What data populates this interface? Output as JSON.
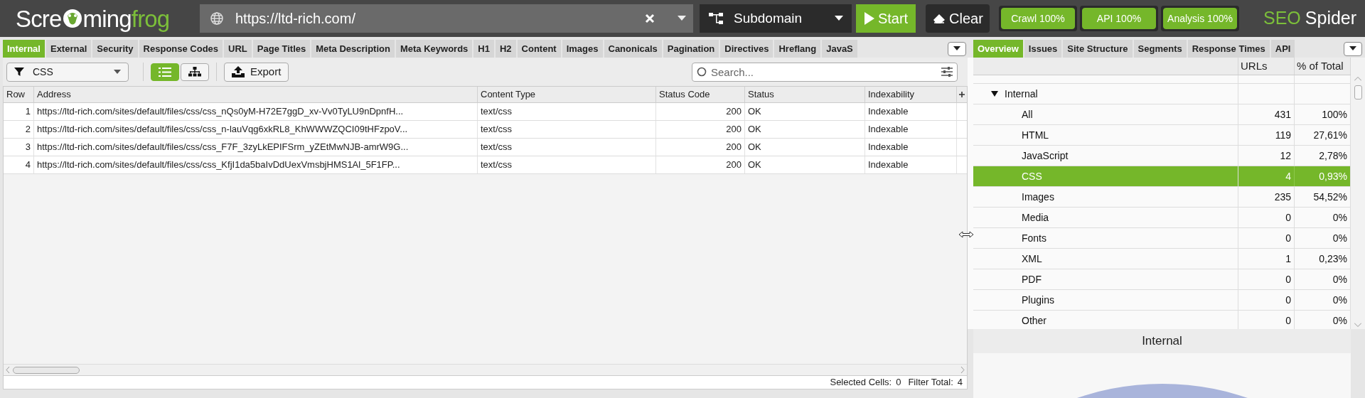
{
  "header": {
    "logo": {
      "part_1": "Scre",
      "part_2": "ming",
      "part_3": "frog"
    },
    "url": "https://ltd-rich.com/",
    "mode": "Subdomain",
    "start": "Start",
    "clear": "Clear",
    "progress": [
      {
        "label": "Crawl 100%",
        "level": 1
      },
      {
        "label": "API 100%",
        "level": 1
      },
      {
        "label": "Analysis 100%",
        "level": 1
      }
    ],
    "product": {
      "part_1": "SEO",
      "part_2": "Spider"
    }
  },
  "left_tabs": [
    {
      "label": "Internal",
      "selected": true
    },
    {
      "label": "External",
      "selected": false
    },
    {
      "label": "Security",
      "selected": false
    },
    {
      "label": "Response Codes",
      "selected": false
    },
    {
      "label": "URL",
      "selected": false
    },
    {
      "label": "Page Titles",
      "selected": false
    },
    {
      "label": "Meta Description",
      "selected": false
    },
    {
      "label": "Meta Keywords",
      "selected": false
    },
    {
      "label": "H1",
      "selected": false
    },
    {
      "label": "H2",
      "selected": false
    },
    {
      "label": "Content",
      "selected": false
    },
    {
      "label": "Images",
      "selected": false
    },
    {
      "label": "Canonicals",
      "selected": false
    },
    {
      "label": "Pagination",
      "selected": false
    },
    {
      "label": "Directives",
      "selected": false
    },
    {
      "label": "Hreflang",
      "selected": false
    },
    {
      "label": "JavaS",
      "selected": false
    }
  ],
  "toolbar": {
    "filter": "CSS",
    "view_modes": [
      {
        "kind": "list",
        "selected": true
      },
      {
        "kind": "tree",
        "selected": false
      }
    ],
    "export": "Export",
    "search_placeholder": "Search..."
  },
  "table": {
    "columns": [
      {
        "label": "Row",
        "kind": "number"
      },
      {
        "label": "Address",
        "kind": "text"
      },
      {
        "label": "Content Type",
        "kind": "text"
      },
      {
        "label": "Status Code",
        "kind": "number"
      },
      {
        "label": "Status",
        "kind": "text"
      },
      {
        "label": "Indexability",
        "kind": "text"
      }
    ],
    "rows": [
      [
        "1",
        "https://ltd-rich.com/sites/default/files/css/css_nQs0yM-H72E7ggD_xv-Vv0TyLU9nDpnfH...",
        "text/css",
        "200",
        "OK",
        "Indexable"
      ],
      [
        "2",
        "https://ltd-rich.com/sites/default/files/css/css_n-lauVqg6xkRL8_KhWWWZQCI09tHFzpoV...",
        "text/css",
        "200",
        "OK",
        "Indexable"
      ],
      [
        "3",
        "https://ltd-rich.com/sites/default/files/css/css_F7F_3zyLkEPIFSrm_yZEtMwNJB-amrW9G...",
        "text/css",
        "200",
        "OK",
        "Indexable"
      ],
      [
        "4",
        "https://ltd-rich.com/sites/default/files/css/css_KfjI1da5baIvDdUexVmsbjHMS1Al_5F1FP...",
        "text/css",
        "200",
        "OK",
        "Indexable"
      ]
    ]
  },
  "status_bar": {
    "selected_label": "Selected Cells:",
    "selected_value": "0",
    "filter_label": "Filter Total:",
    "filter_value": "4"
  },
  "right_tabs": [
    {
      "label": "Overview",
      "selected": true
    },
    {
      "label": "Issues",
      "selected": false
    },
    {
      "label": "Site Structure",
      "selected": false
    },
    {
      "label": "Segments",
      "selected": false
    },
    {
      "label": "Response Times",
      "selected": false
    },
    {
      "label": "API",
      "selected": false
    }
  ],
  "overview": {
    "columns": [
      "URLs",
      "% of Total"
    ],
    "tree": [
      {
        "label": "Internal",
        "expanded": true,
        "children": [
          {
            "label": "All",
            "urls": "431",
            "percent": "100%",
            "selected": false
          },
          {
            "label": "HTML",
            "urls": "119",
            "percent": "27,61%",
            "selected": false
          },
          {
            "label": "JavaScript",
            "urls": "12",
            "percent": "2,78%",
            "selected": false
          },
          {
            "label": "CSS",
            "urls": "4",
            "percent": "0,93%",
            "selected": true
          },
          {
            "label": "Images",
            "urls": "235",
            "percent": "54,52%",
            "selected": false
          },
          {
            "label": "Media",
            "urls": "0",
            "percent": "0%",
            "selected": false
          },
          {
            "label": "Fonts",
            "urls": "0",
            "percent": "0%",
            "selected": false
          },
          {
            "label": "XML",
            "urls": "1",
            "percent": "0,23%",
            "selected": false
          },
          {
            "label": "PDF",
            "urls": "0",
            "percent": "0%",
            "selected": false
          },
          {
            "label": "Plugins",
            "urls": "0",
            "percent": "0%",
            "selected": false
          },
          {
            "label": "Other",
            "urls": "0",
            "percent": "0%",
            "selected": false
          }
        ]
      }
    ]
  },
  "chart_title": "Internal"
}
